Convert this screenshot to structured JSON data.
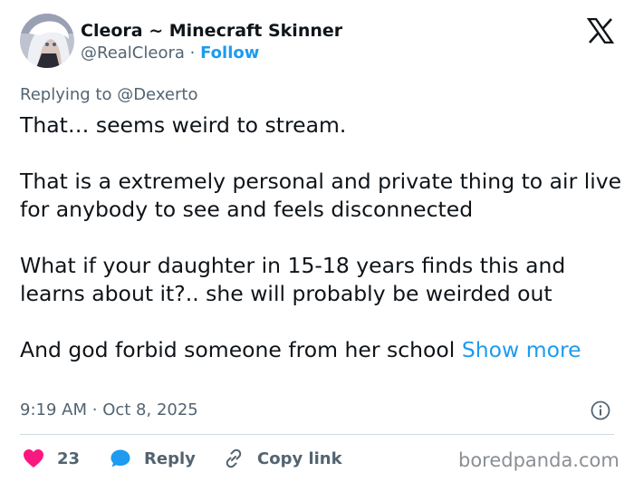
{
  "author": {
    "display_name": "Cleora ~ Minecraft Skinner",
    "handle": "@RealCleora",
    "separator": "·",
    "follow_label": "Follow",
    "avatar_icon": "anime-avatar-icon"
  },
  "platform_icon": "x-logo-icon",
  "reply_context": "Replying to @Dexerto",
  "post": {
    "paragraphs": [
      "That… seems weird to stream.",
      "That is a extremely personal and private thing to air live for anybody to see and feels disconnected",
      "What if your daughter in 15-18 years finds this and learns about it?.. she will probably be weirded out"
    ],
    "last_paragraph": "And god forbid someone from her school",
    "show_more_label": "Show more"
  },
  "timestamp": {
    "time": "9:19 AM",
    "separator": "·",
    "date": "Oct 8, 2025"
  },
  "actions": {
    "like_count": "23",
    "reply_label": "Reply",
    "copy_link_label": "Copy link"
  },
  "watermark": "boredpanda.com",
  "colors": {
    "link_blue": "#1d9bf0",
    "muted_text": "#536471",
    "like_red": "#f91880",
    "reply_blue": "#1d9bf0"
  }
}
